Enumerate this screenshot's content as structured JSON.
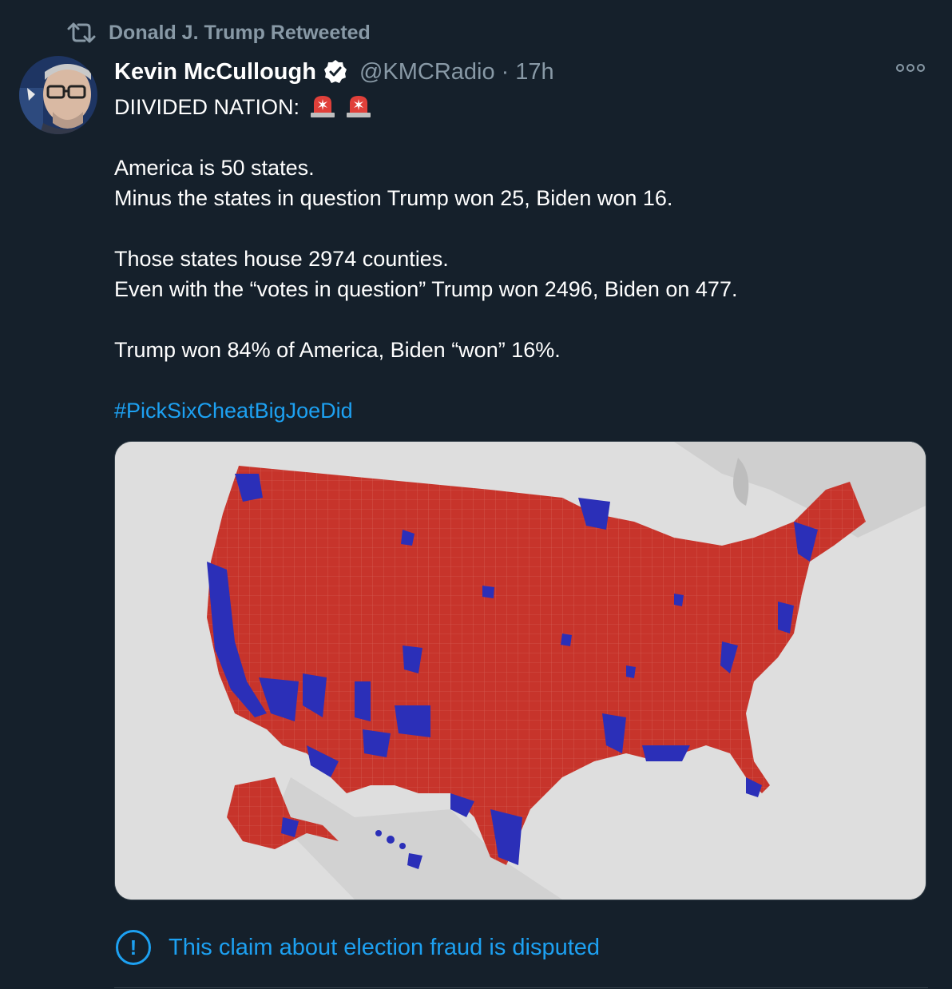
{
  "retweet": {
    "icon": "retweet-icon",
    "text": "Donald J. Trump Retweeted"
  },
  "tweet": {
    "author_name": "Kevin McCullough",
    "verified_icon": "verified-badge-icon",
    "handle": "@KMCRadio",
    "separator": "·",
    "time": "17h",
    "more_icon": "more-options-icon",
    "lines": {
      "l1": "DIIVIDED NATION:",
      "l2": "America is 50 states.",
      "l3": "Minus the states in question Trump won 25, Biden won 16.",
      "l4": "Those states house 2974 counties.",
      "l5": "Even with the “votes in question” Trump won 2496, Biden on 477.",
      "l6": "Trump won 84% of America, Biden “won” 16%."
    },
    "hashtag": "#PickSixCheatBigJoeDid",
    "emoji": "police-siren-icon"
  },
  "media": {
    "description_colors": {
      "background": "#d9d9d9",
      "red": "#c7342b",
      "blue": "#2b2fb8"
    }
  },
  "notice": {
    "icon": "exclamation-circle-icon",
    "text": "This claim about election fraud is disputed"
  },
  "colors": {
    "background": "#15202b",
    "secondary_text": "#8899a6",
    "link": "#1da1f2",
    "border": "#38444d"
  }
}
